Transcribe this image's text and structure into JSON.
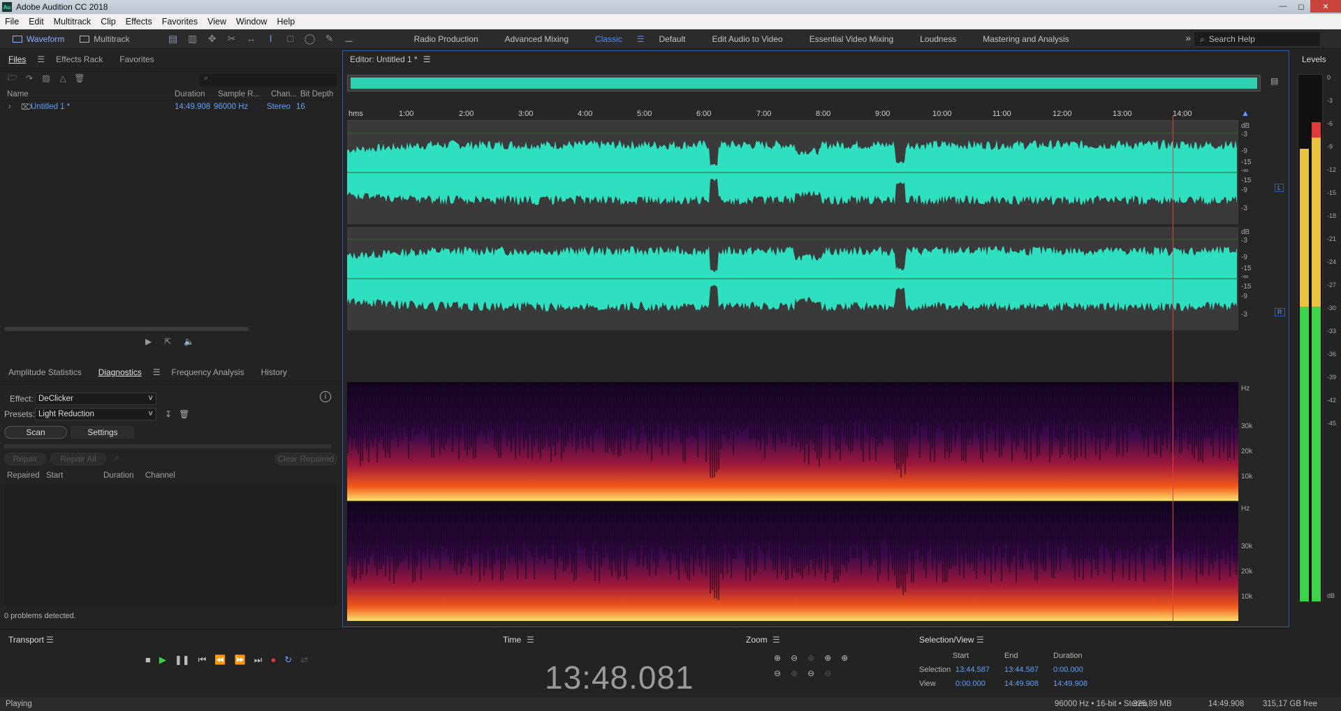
{
  "app": {
    "title": "Adobe Audition CC 2018",
    "icon_label": "Au"
  },
  "menu": [
    "File",
    "Edit",
    "Multitrack",
    "Clip",
    "Effects",
    "Favorites",
    "View",
    "Window",
    "Help"
  ],
  "toolbar": {
    "waveform": "Waveform",
    "multitrack": "Multitrack",
    "workspaces": [
      "Radio Production",
      "Advanced Mixing",
      "Classic",
      "Default",
      "Edit Audio to Video",
      "Essential Video Mixing",
      "Loudness",
      "Mastering and Analysis"
    ],
    "active_workspace": "Classic",
    "search_placeholder": "Search Help"
  },
  "files_panel": {
    "tabs": [
      "Files",
      "Effects Rack",
      "Favorites"
    ],
    "headers": [
      "Name",
      "Duration",
      "Sample R...",
      "Chan...",
      "Bit Depth"
    ],
    "rows": [
      {
        "name": "Untitled 1 *",
        "duration": "14:49.908",
        "sample_rate": "96000 Hz",
        "channels": "Stereo",
        "bit_depth": "16"
      }
    ]
  },
  "diagnostics": {
    "tabs": [
      "Amplitude Statistics",
      "Diagnostics",
      "Frequency Analysis",
      "History"
    ],
    "effect_label": "Effect:",
    "effect": "DeClicker",
    "presets_label": "Presets:",
    "preset": "Light Reduction",
    "scan": "Scan",
    "settings": "Settings",
    "repair": "Repair",
    "repair_all": "Repair All",
    "clear_repaired": "Clear Repaired",
    "headers": [
      "Repaired",
      "Start",
      "Duration",
      "Channel"
    ],
    "status": "0 problems detected."
  },
  "editor": {
    "title": "Editor: Untitled 1 *",
    "ruler": [
      "hms",
      "1:00",
      "2:00",
      "3:00",
      "4:00",
      "5:00",
      "6:00",
      "7:00",
      "8:00",
      "9:00",
      "10:00",
      "11:00",
      "12:00",
      "13:00",
      "14:00"
    ],
    "db_labels": [
      "dB",
      "-3",
      "-9",
      "-15",
      "-∞",
      "-15",
      "-9",
      "-3"
    ],
    "hz_labels": [
      "Hz",
      "30k",
      "20k",
      "10k"
    ],
    "left": "L",
    "right": "R",
    "playhead_fraction": 0.926,
    "accent": "#2ee0c0"
  },
  "levels": {
    "title": "Levels",
    "scale": [
      "0",
      "-3",
      "-6",
      "-9",
      "-12",
      "-15",
      "-18",
      "-21",
      "-24",
      "-27",
      "-30",
      "-33",
      "-36",
      "-39",
      "-42",
      "-45",
      "dB"
    ]
  },
  "transport": {
    "title": "Transport"
  },
  "time": {
    "title": "Time",
    "value": "13:48.081"
  },
  "zoom": {
    "title": "Zoom"
  },
  "selection": {
    "title": "Selection/View",
    "headers": [
      "Start",
      "End",
      "Duration"
    ],
    "selection_label": "Selection",
    "selection": [
      "13:44.587",
      "13:44.587",
      "0:00.000"
    ],
    "view_label": "View",
    "view": [
      "0:00.000",
      "14:49.908",
      "14:49.908"
    ]
  },
  "status": {
    "left": "Playing",
    "format": "96000 Hz • 16-bit • Stereo",
    "size": "325,89 MB",
    "duration": "14:49.908",
    "free": "315,17 GB free"
  }
}
